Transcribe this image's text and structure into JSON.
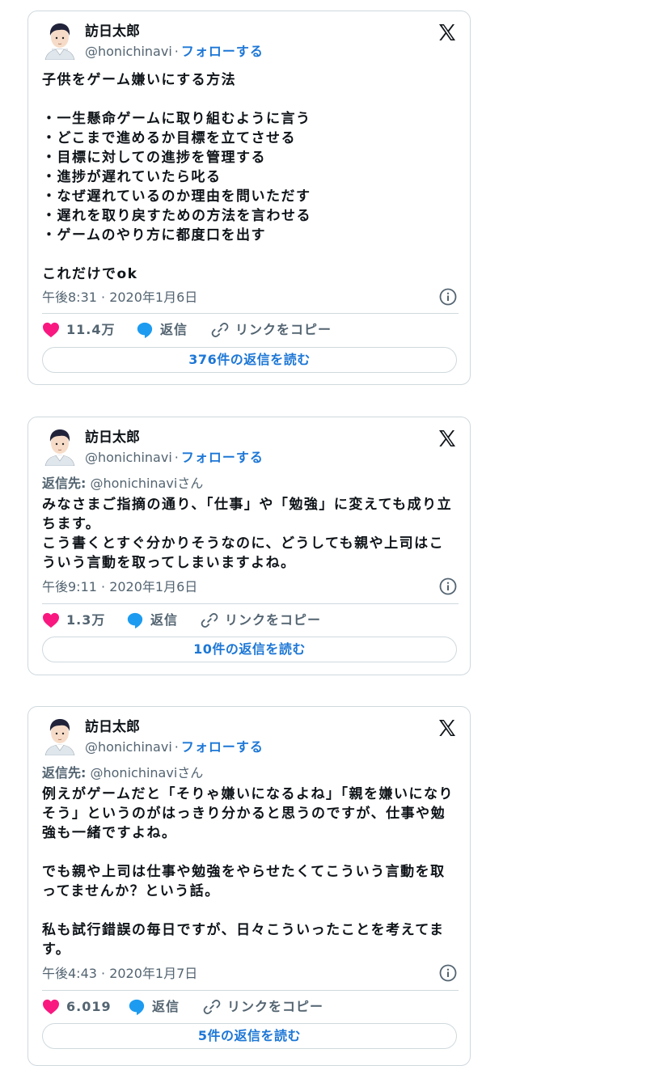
{
  "tweets": [
    {
      "author_name": "訪日太郎",
      "handle": "@honichinavi",
      "separator": "·",
      "follow_label": "フォローする",
      "reply_to_label": "",
      "reply_to_handle": "",
      "body": "子供をゲーム嫌いにする方法\n\n・一生懸命ゲームに取り組むように言う\n・どこまで進めるか目標を立てさせる\n・目標に対しての進捗を管理する\n・進捗が遅れていたら叱る\n・なぜ遅れているのか理由を問いただす\n・遅れを取り戻すための方法を言わせる\n・ゲームのやり方に都度口を出す\n\nこれだけでok",
      "time": "午後8:31 · 2020年1月6日",
      "likes": "11.4万",
      "reply_label": "返信",
      "copy_label": "リンクをコピー",
      "read_replies": "376件の返信を読む"
    },
    {
      "author_name": "訪日太郎",
      "handle": "@honichinavi",
      "separator": "·",
      "follow_label": "フォローする",
      "reply_to_label": "返信先:",
      "reply_to_handle": "@honichinaviさん",
      "body": "みなさまご指摘の通り、「仕事」や「勉強」に変えても成り立ちます。\nこう書くとすぐ分かりそうなのに、どうしても親や上司はこういう言動を取ってしまいますよね。",
      "time": "午後9:11 · 2020年1月6日",
      "likes": "1.3万",
      "reply_label": "返信",
      "copy_label": "リンクをコピー",
      "read_replies": "10件の返信を読む"
    },
    {
      "author_name": "訪日太郎",
      "handle": "@honichinavi",
      "separator": "·",
      "follow_label": "フォローする",
      "reply_to_label": "返信先:",
      "reply_to_handle": "@honichinaviさん",
      "body": "例えがゲームだと「そりゃ嫌いになるよね」「親を嫌いになりそう」というのがはっきり分かると思うのですが、仕事や勉強も一緒ですよね。\n\nでも親や上司は仕事や勉強をやらせたくてこういう言動を取ってませんか？という話。\n\n私も試行錯誤の毎日ですが、日々こういったことを考えてます。",
      "time": "午後4:43 · 2020年1月7日",
      "likes": "6.019",
      "reply_label": "返信",
      "copy_label": "リンクをコピー",
      "read_replies": "5件の返信を読む"
    }
  ],
  "colors": {
    "like": "#f91880",
    "reply": "#1d9bf0",
    "link": "#1d77d6",
    "border": "#cfd9de",
    "muted": "#536471"
  },
  "icons": [
    "avatar-illustration",
    "x-logo-icon",
    "info-icon",
    "heart-icon",
    "reply-bubble-icon",
    "link-icon"
  ]
}
